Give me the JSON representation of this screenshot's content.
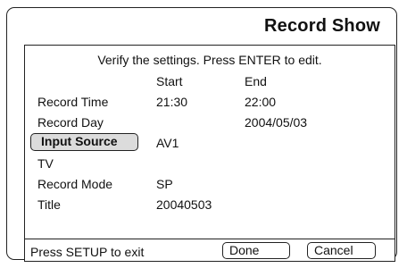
{
  "screen": {
    "title": "Record Show"
  },
  "panel": {
    "instruction": "Verify the settings. Press ENTER to edit.",
    "columns": {
      "start": "Start",
      "end": "End"
    },
    "rows": [
      {
        "label": "Record Time",
        "start": "21:30",
        "end": "22:00"
      },
      {
        "label": "Record Day",
        "start": "",
        "end": "2004/05/03"
      },
      {
        "label": "Input Source",
        "start": "AV1",
        "end": "",
        "selected": true
      },
      {
        "label": "TV",
        "start": "",
        "end": ""
      },
      {
        "label": "Record Mode",
        "start": "SP",
        "end": ""
      },
      {
        "label": "Title",
        "start": "20040503",
        "end": ""
      }
    ]
  },
  "footer": {
    "hint": "Press SETUP to exit",
    "done_label": "Done",
    "cancel_label": "Cancel"
  }
}
